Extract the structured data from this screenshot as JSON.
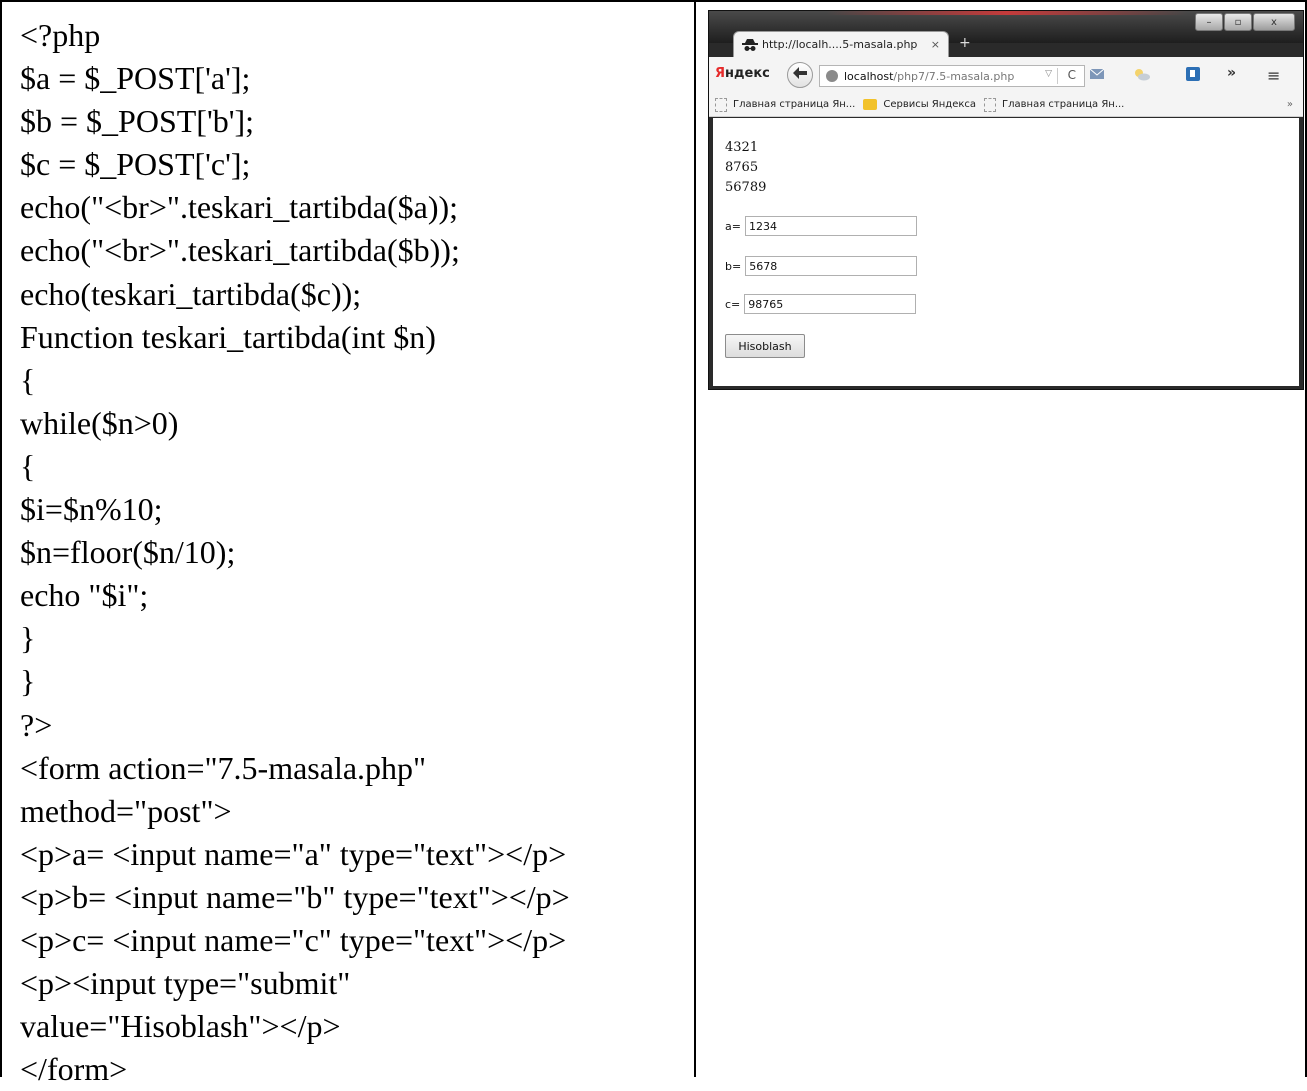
{
  "code_lines": [
    "<?php",
    "$a = $_POST['a'];",
    "$b = $_POST['b'];",
    "$c = $_POST['c'];",
    "echo(\"<br>\".teskari_tartibda($a));",
    "echo(\"<br>\".teskari_tartibda($b));",
    "echo(teskari_tartibda($c));",
    "Function teskari_tartibda(int $n)",
    "{",
    "while($n>0)",
    "{",
    "$i=$n%10;",
    "$n=floor($n/10);",
    "echo \"$i\";",
    "}",
    "}",
    "?>",
    "<form action=\"7.5-masala.php\"",
    "method=\"post\">",
    "<p>a= <input name=\"a\" type=\"text\"></p>",
    "<p>b= <input name=\"b\" type=\"text\"></p>",
    "<p>c= <input name=\"c\" type=\"text\"></p>",
    "<p><input type=\"submit\"",
    "value=\"Hisoblash\"></p>",
    "</form>"
  ],
  "browser": {
    "window_controls": {
      "minimize": "–",
      "maximize": "▫",
      "close": "x"
    },
    "tab": {
      "title": "http://localh....5-masala.php",
      "close": "×"
    },
    "new_tab": "+",
    "brand": {
      "first": "Я",
      "rest": "ндекс"
    },
    "url": {
      "host": "localhost",
      "path": "/php7/7.5-masala.php"
    },
    "toolbar": {
      "overflow": "»",
      "menu": "≡"
    },
    "bookmarks": [
      {
        "label": "Главная страница Ян...",
        "icon": "page"
      },
      {
        "label": "Сервисы Яндекса",
        "icon": "folder"
      },
      {
        "label": "Главная страница Ян...",
        "icon": "page"
      }
    ],
    "bookmarks_more": "»",
    "output": [
      "4321",
      "8765",
      "56789"
    ],
    "fields": [
      {
        "label": "a=",
        "value": "1234"
      },
      {
        "label": "b=",
        "value": "5678"
      },
      {
        "label": "c=",
        "value": "98765"
      }
    ],
    "submit_label": "Hisoblash"
  },
  "colors": {
    "yandex_red": "#e62b2b",
    "folder_yellow": "#f2c22a"
  }
}
